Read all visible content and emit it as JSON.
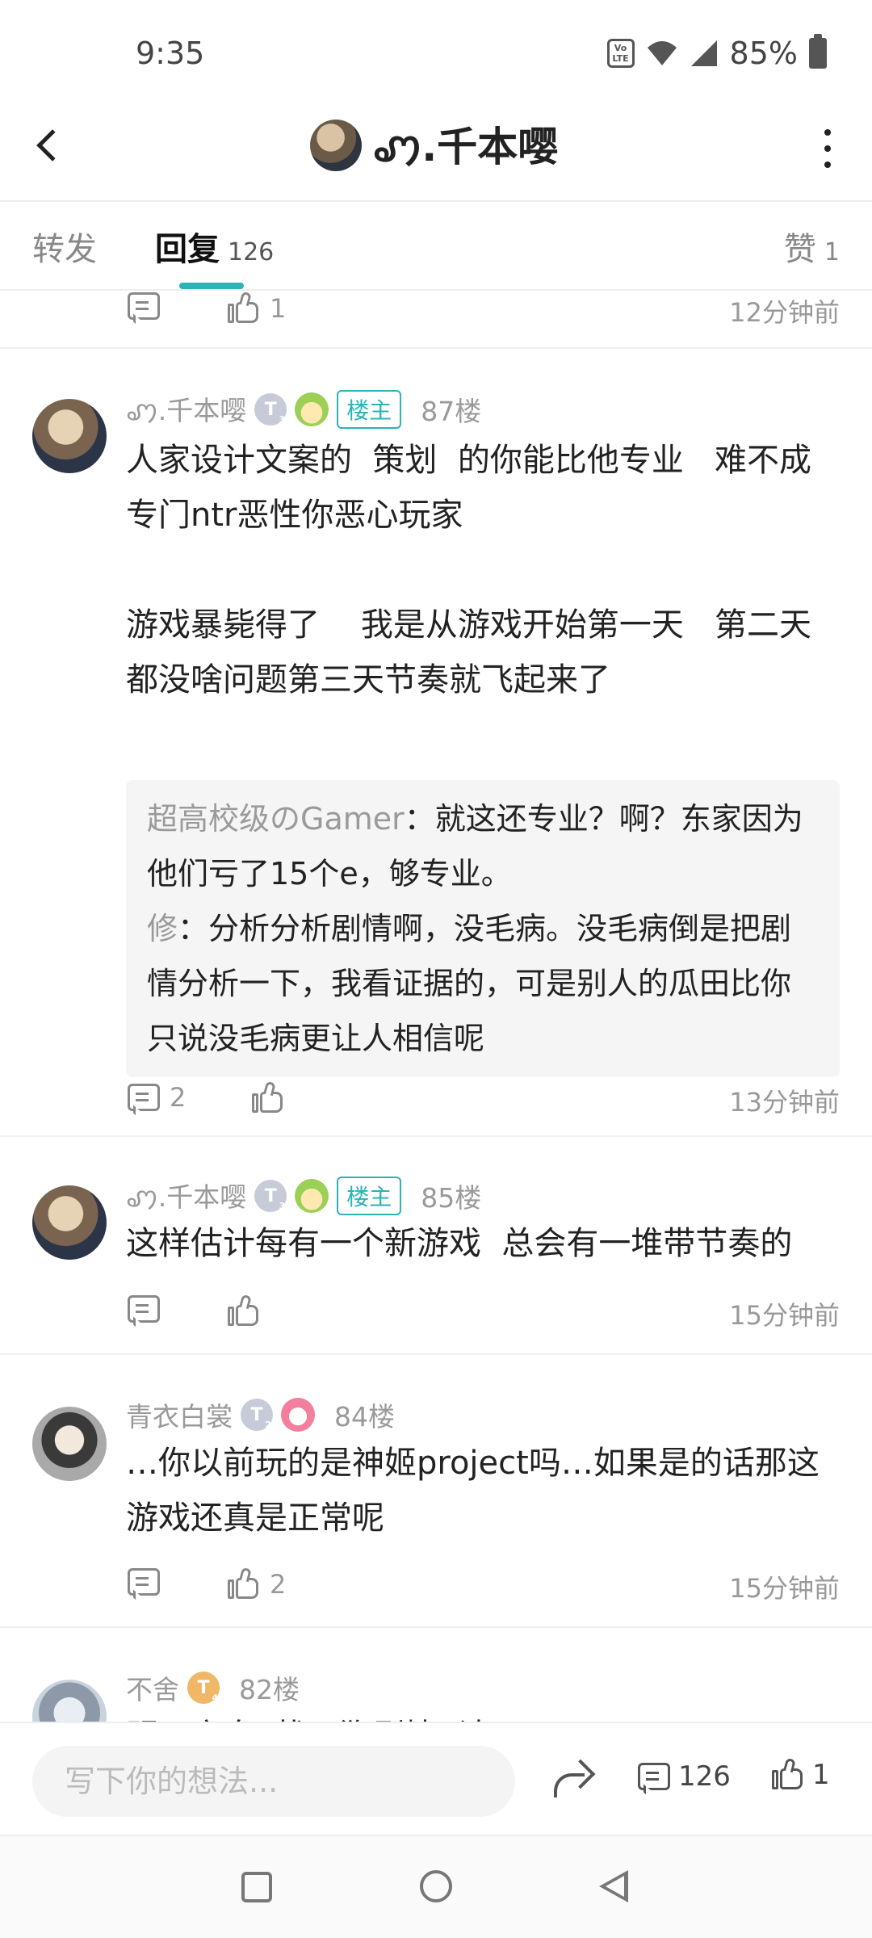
{
  "status_bar": {
    "time": "9:35",
    "volte": "Vo LTE",
    "battery": "85%"
  },
  "header": {
    "title": "ꩇ.千本嘤"
  },
  "tabs": {
    "forward": "转发",
    "reply": "回复",
    "reply_count": "126",
    "like": "赞",
    "like_count": "1"
  },
  "top_row": {
    "like_count": "1",
    "time": "12分钟前"
  },
  "posts": [
    {
      "user": "ꩇ.千本嘤",
      "level": "T",
      "owner_tag": "楼主",
      "floor": "87楼",
      "text": "人家设计文案的  策划  的你能比他专业   难不成专门ntr恶性你恶心玩家\n\n游戏暴毙得了    我是从游戏开始第一天   第二天都没啥问题第三天节奏就飞起来了",
      "replies": [
        {
          "user": "超高校级のGamer",
          "sep": "：",
          "text": "就这还专业？啊？东家因为他们亏了15个e，够专业。"
        },
        {
          "user": "修",
          "sep": "：",
          "text": "分析分析剧情啊，没毛病。没毛病倒是把剧情分析一下，我看证据的，可是别人的瓜田比你只说没毛病更让人相信呢"
        }
      ],
      "comment_count": "2",
      "time": "13分钟前"
    },
    {
      "user": "ꩇ.千本嘤",
      "level": "T",
      "owner_tag": "楼主",
      "floor": "85楼",
      "text": "这样估计每有一个新游戏  总会有一堆带节奏的",
      "time": "15分钟前"
    },
    {
      "user": "青衣白裳",
      "level": "T",
      "floor": "84楼",
      "text": "…你以前玩的是神姬project吗…如果是的话那这游戏还真是正常呢",
      "like_count": "2",
      "time": "15分钟前"
    },
    {
      "user": "不舍",
      "level": "T",
      "floor": "82楼",
      "text": "明日方舟  找天狗剧情  请"
    }
  ],
  "bottom_bar": {
    "placeholder": "写下你的想法...",
    "comment_count": "126",
    "like_count": "1"
  }
}
